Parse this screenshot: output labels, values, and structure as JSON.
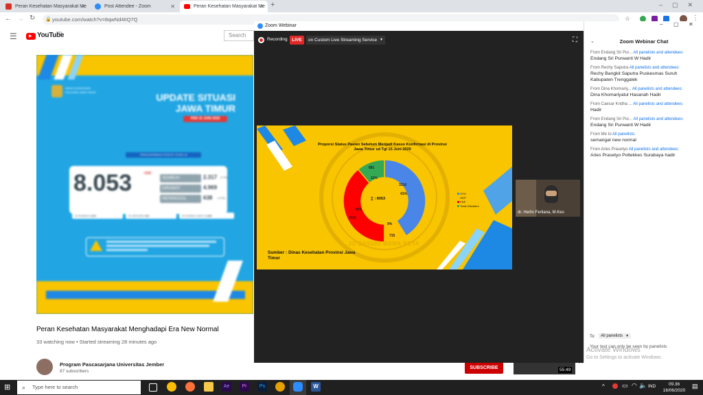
{
  "browser": {
    "tabs": [
      {
        "title": "Peran Kesehatan Masyarakat Me",
        "icon": "gmail-icon",
        "color": "#d93025"
      },
      {
        "title": "Post Attendee - Zoom",
        "icon": "zoom-icon",
        "color": "#2d8cff"
      },
      {
        "title": "Peran Kesehatan Masyarakat Me",
        "icon": "youtube-icon",
        "color": "#ff0000"
      }
    ],
    "new_tab": "+",
    "url": "youtube.com/watch?v=8qwNd4IIQ7Q"
  },
  "youtube": {
    "logo": "YouTube",
    "logo_sup": "ID",
    "search_placeholder": "Search",
    "video_title": "Peran Kesehatan Masyarakat Menghadapi Era New Normal",
    "video_meta": "33 watching now • Started streaming 28 minutes ago",
    "channel_name": "Program Pascasarjana Universitas Jember",
    "channel_subs": "87 subscribers",
    "subscribe": "SUBSCRIBE",
    "thumb_time": "55:49",
    "thumb_prefix": "Fi",
    "infographic": {
      "agency_line1": "DINAS KESEHATAN",
      "agency_line2": "PROVINSI JAWA TIMUR",
      "title_line1": "UPDATE SITUASI",
      "title_line2": "JAWA TIMUR",
      "date": "PER 15 JUNI 2020",
      "subtitle": "TERKONFIRMASI POSITIF COVID-19",
      "total": "8.053",
      "total_delta": "+202",
      "rows": [
        {
          "label": "SEMBUH",
          "value": "2.317",
          "pct": "(+7%)"
        },
        {
          "label": "DIRAWAT",
          "value": "4.969",
          "pct": ""
        },
        {
          "label": "MENINGGAL",
          "value": "638",
          "pct": "(+1%)"
        }
      ],
      "sub_rows": [
        {
          "label": "DI RUMAH",
          "value": "2.264"
        },
        {
          "label": "DI GEDUNG",
          "value": "422"
        },
        {
          "label": "DI RUMAH SAKIT",
          "value": "2.283"
        }
      ]
    }
  },
  "zoom": {
    "window_title": "Zoom Webinar",
    "recording": "Recording",
    "live": "LIVE",
    "stream_service": "on Custom Live Streaming Service",
    "participant_name": "dr. Herlin Ferliana, M.Kes",
    "slide": {
      "title": "Proporsi Status Pasien Sebelum Menjadi Kasus Konfirmasi di Provinsi Jawa Timur  sd Tgl 15 Juni 2020",
      "center_label": "∑ : 8053",
      "source": "Sumber : Dinas Kesehatan Provinsi Jawa Timur",
      "watermark": "JO BASUKI MAWA BEYA"
    }
  },
  "chart_data": {
    "type": "donut",
    "title": "Proporsi Status Pasien Sebelum Menjadi Kasus Konfirmasi di Provinsi Jawa Timur  sd Tgl 15 Juni 2020",
    "total": 8053,
    "series": [
      {
        "name": "OTG",
        "value": 3316,
        "pct": "41%",
        "color": "#4a86e8"
      },
      {
        "name": "ODP",
        "value": 715,
        "pct": "9%",
        "color": "#ffc000"
      },
      {
        "name": "PDP",
        "value": 3131,
        "pct": "39%",
        "color": "#ff0000"
      },
      {
        "name": "Tidak Diketahui",
        "value": 891,
        "pct": "11%",
        "color": "#34a853"
      }
    ],
    "legend_position": "right"
  },
  "chat": {
    "title": "Zoom Webinar Chat",
    "messages": [
      {
        "from": "From Endang Sri Pur...",
        "to": "All panelists and attendees:",
        "text": "Endang Sri Purwanti W Hadir"
      },
      {
        "from": "From Rechy Saputra",
        "to": "All panelists and attendees:",
        "text": "Rechy Bangkit Saputra Puskesmas Suruh Kabupaten Trenggalek"
      },
      {
        "from": "From Dina Khomariy...",
        "to": "All panelists and attendees:",
        "text": "Dina Khomariyatul Hasanah Hadir"
      },
      {
        "from": "From Caesar Kridha ...",
        "to": "All panelists and attendees:",
        "text": "Hadir"
      },
      {
        "from": "From Endang Sri Pur...",
        "to": "All panelists and attendees:",
        "text": "Endang Sri Purwanti W Hadir"
      },
      {
        "from": "From Me to",
        "to": "All panelists:",
        "text": "semangat new normal"
      },
      {
        "from": "From Aries Prasetyo",
        "to": "All panelists and attendees:",
        "text": "Aries Prasetyo Poltekkes Surabaya hadir"
      }
    ],
    "to_label": "To:",
    "to_value": "All panelists",
    "notice": "Your text can only be seen by panelists",
    "activate_line1": "Activate Windows",
    "activate_line2": "Go to Settings to activate Windows."
  },
  "taskbar": {
    "search_placeholder": "Type here to search",
    "lang": "IND",
    "time": "09.36",
    "date": "16/06/2020"
  }
}
